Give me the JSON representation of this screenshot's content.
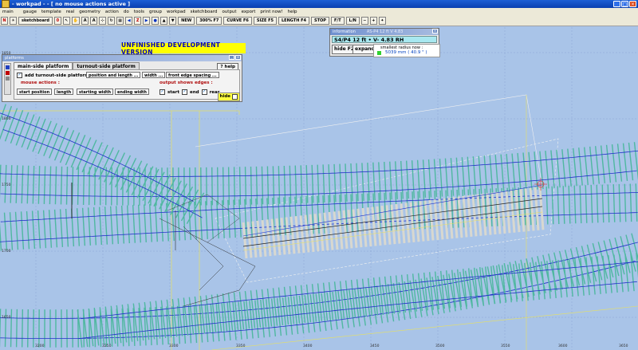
{
  "window": {
    "title": "- workpad - - [ no mouse actions active ]"
  },
  "menu": [
    "main",
    "",
    "gauge",
    "template",
    "real",
    "geometry",
    "action",
    "do",
    "tools",
    "group",
    "workpad",
    "sketchboard",
    "output",
    "export",
    "print now!",
    "help"
  ],
  "toolbar": {
    "sketchboard_label": "sketchboard",
    "zero_label": "0",
    "new_label": "NEW",
    "zoom_label": "300% F7",
    "curve_label": "CURVE F6",
    "size_label": "SIZE F5",
    "length_label": "LENGTH F4",
    "stop_label": "STOP",
    "ft_label": "F/T",
    "ln_label": "L/N",
    "z_label": "Z"
  },
  "banner": {
    "text": "UNFINISHED DEVELOPMENT VERSION"
  },
  "platform_panel": {
    "title": "platforms",
    "tabs": [
      "main-side platform",
      "turnout-side platform"
    ],
    "help_label": "? help",
    "add_label": "add turnout-side platform",
    "add_checked": true,
    "position_btn": "position and length ...",
    "width_btn": "width ...",
    "front_edge_btn": "front edge spacing ...",
    "mouse_actions_label": "mouse actions :",
    "output_edges_label": "output shows edges :",
    "mouse_buttons": [
      "start position",
      "length",
      "starting width",
      "ending width"
    ],
    "edges": [
      {
        "label": "start",
        "checked": true
      },
      {
        "label": "end",
        "checked": true
      },
      {
        "label": "rear",
        "checked": true
      }
    ],
    "hide_label": "hide"
  },
  "info_panel": {
    "title": "information",
    "title_extra": "AS-P4 12 ft  V  4.83",
    "status": "S4/P4  12 ft  •  V- 4.83  RH",
    "hide_label": "hide F2",
    "expand_label": "expand",
    "radius_title": "smallest radius now :",
    "radius_value": "5039 mm ( 40.9 \" )"
  },
  "axis": {
    "x_labels": [
      "3200",
      "3250",
      "3300",
      "3350",
      "3400",
      "3450",
      "3500",
      "3550",
      "3600",
      "3650"
    ],
    "y_labels": [
      "1850",
      "1800",
      "1750",
      "1700",
      "1650"
    ]
  },
  "colors": {
    "background": "#a9c4e8",
    "sleepers": "#4fb8a0",
    "rails": "#2030c8",
    "template_sleepers": "#d8d8d0",
    "banner": "#ffff00"
  }
}
